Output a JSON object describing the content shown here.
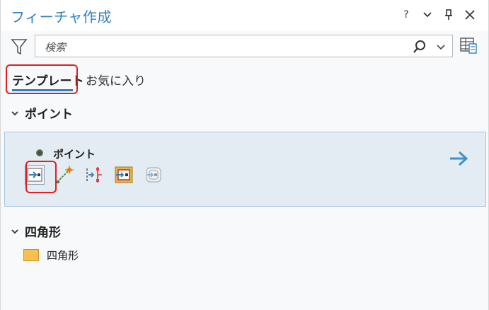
{
  "window": {
    "title": "フィーチャ作成",
    "controls": {
      "help": "?",
      "menu": "menu",
      "pin": "pin",
      "close": "close"
    }
  },
  "search": {
    "placeholder": "検索"
  },
  "tabs": [
    {
      "label": "テンプレート",
      "selected": true
    },
    {
      "label": "お気に入り",
      "selected": false
    }
  ],
  "groups": [
    {
      "label": "ポイント",
      "templates": [
        {
          "name": "ポイント",
          "tools": [
            {
              "icon": "point-tool-icon",
              "active": true
            },
            {
              "icon": "point-at-end-of-line-icon",
              "active": false
            },
            {
              "icon": "point-along-line-icon",
              "active": false
            },
            {
              "icon": "point-in-polygon-icon",
              "active": false
            },
            {
              "icon": "point-at-intersection-icon",
              "active": false
            }
          ]
        }
      ]
    },
    {
      "label": "四角形",
      "templates": [
        {
          "name": "四角形",
          "swatch_color": "#f8c04d"
        }
      ]
    }
  ],
  "colors": {
    "accent": "#2f7fc1",
    "highlight": "#e02020",
    "card_bg": "#e3ecf3"
  }
}
